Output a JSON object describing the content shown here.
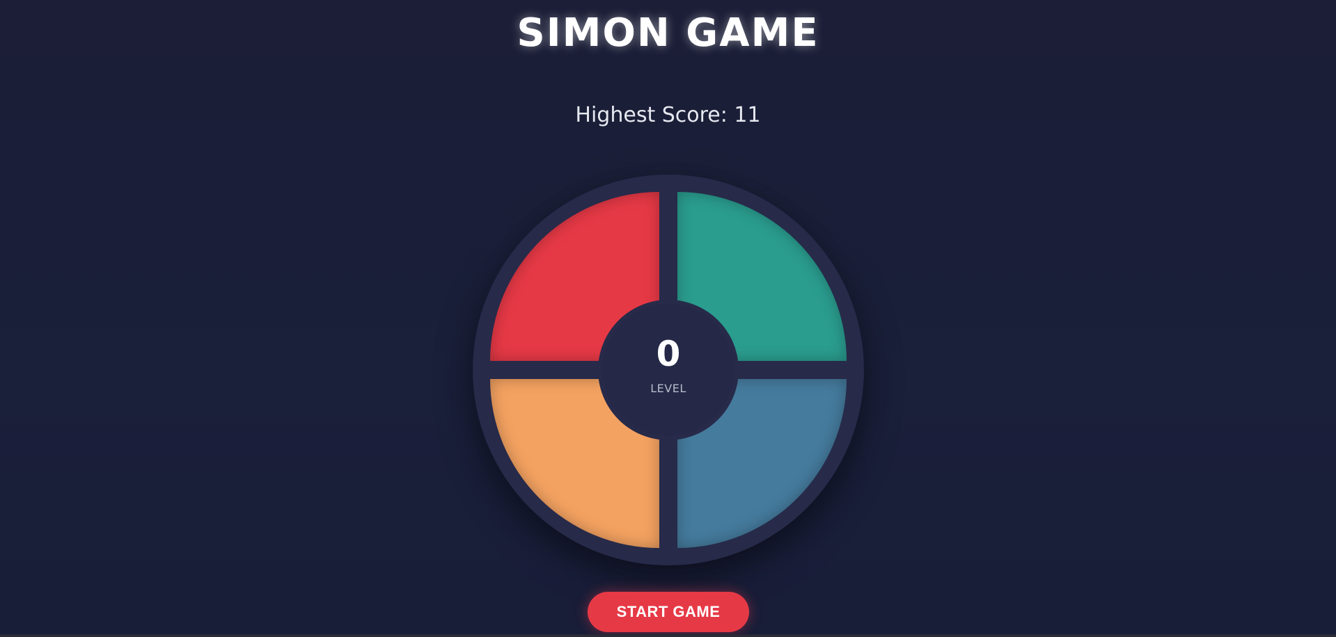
{
  "title": "SIMON GAME",
  "highest_score": {
    "text": "Highest Score: 11",
    "value": 11
  },
  "board": {
    "pads": [
      {
        "name": "red",
        "color": "#e63946"
      },
      {
        "name": "green",
        "color": "#2a9d8f"
      },
      {
        "name": "orange",
        "color": "#f4a261"
      },
      {
        "name": "blue",
        "color": "#457b9d"
      }
    ],
    "level": {
      "value": "0",
      "label": "LEVEL"
    }
  },
  "start_button": {
    "label": "START GAME",
    "color": "#e63946"
  }
}
